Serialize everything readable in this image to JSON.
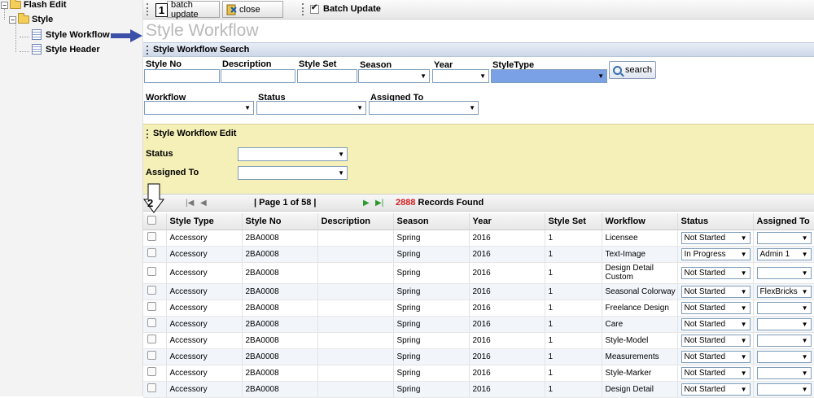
{
  "tree": {
    "root": "Flash Edit",
    "style": "Style",
    "children": [
      "Style Workflow",
      "Style Header"
    ]
  },
  "toolbar": {
    "batch_update": "batch update",
    "close": "close",
    "batch_update_checkbox": "Batch Update"
  },
  "callouts": {
    "one": "1",
    "two": "2"
  },
  "page_title": "Style Workflow",
  "search": {
    "header": "Style Workflow Search",
    "labels": {
      "style_no": "Style No",
      "description": "Description",
      "style_set": "Style Set",
      "season": "Season",
      "year": "Year",
      "style_type": "StyleType",
      "workflow": "Workflow",
      "status": "Status",
      "assigned_to": "Assigned To"
    },
    "button": "search"
  },
  "edit": {
    "header": "Style Workflow Edit",
    "status_label": "Status",
    "assigned_label": "Assigned To"
  },
  "pager": {
    "page_info": "| Page 1 of 58 |",
    "records_count": "2888",
    "records_label": "Records Found"
  },
  "grid": {
    "columns": [
      "",
      "Style Type",
      "Style No",
      "Description",
      "Season",
      "Year",
      "Style Set",
      "Workflow",
      "Status",
      "Assigned To"
    ],
    "rows": [
      {
        "type": "Accessory",
        "no": "2BA0008",
        "desc": "",
        "season": "Spring",
        "year": "2016",
        "set": "1",
        "workflow": "Licensee",
        "status": "Not Started",
        "assigned": ""
      },
      {
        "type": "Accessory",
        "no": "2BA0008",
        "desc": "",
        "season": "Spring",
        "year": "2016",
        "set": "1",
        "workflow": "Text-Image",
        "status": "In Progress",
        "assigned": "Admin 1"
      },
      {
        "type": "Accessory",
        "no": "2BA0008",
        "desc": "",
        "season": "Spring",
        "year": "2016",
        "set": "1",
        "workflow": "Design Detail Custom",
        "status": "Not Started",
        "assigned": ""
      },
      {
        "type": "Accessory",
        "no": "2BA0008",
        "desc": "",
        "season": "Spring",
        "year": "2016",
        "set": "1",
        "workflow": "Seasonal Colorway",
        "status": "Not Started",
        "assigned": "FlexBricks"
      },
      {
        "type": "Accessory",
        "no": "2BA0008",
        "desc": "",
        "season": "Spring",
        "year": "2016",
        "set": "1",
        "workflow": "Freelance Design",
        "status": "Not Started",
        "assigned": ""
      },
      {
        "type": "Accessory",
        "no": "2BA0008",
        "desc": "",
        "season": "Spring",
        "year": "2016",
        "set": "1",
        "workflow": "Care",
        "status": "Not Started",
        "assigned": ""
      },
      {
        "type": "Accessory",
        "no": "2BA0008",
        "desc": "",
        "season": "Spring",
        "year": "2016",
        "set": "1",
        "workflow": "Style-Model",
        "status": "Not Started",
        "assigned": ""
      },
      {
        "type": "Accessory",
        "no": "2BA0008",
        "desc": "",
        "season": "Spring",
        "year": "2016",
        "set": "1",
        "workflow": "Measurements",
        "status": "Not Started",
        "assigned": ""
      },
      {
        "type": "Accessory",
        "no": "2BA0008",
        "desc": "",
        "season": "Spring",
        "year": "2016",
        "set": "1",
        "workflow": "Style-Marker",
        "status": "Not Started",
        "assigned": ""
      },
      {
        "type": "Accessory",
        "no": "2BA0008",
        "desc": "",
        "season": "Spring",
        "year": "2016",
        "set": "1",
        "workflow": "Design Detail",
        "status": "Not Started",
        "assigned": ""
      }
    ]
  },
  "colors": {
    "arrow": "#3b4fa8",
    "records_count": "#d01f1f",
    "edit_panel": "#f5f0b8",
    "styletype_select": "#7aa1e6"
  },
  "icons": [
    "folder-icon",
    "document-icon",
    "close-icon",
    "search-icon",
    "first-page-icon",
    "prev-page-icon",
    "next-page-icon",
    "last-page-icon",
    "arrow-right-icon",
    "arrow-down-icon"
  ]
}
